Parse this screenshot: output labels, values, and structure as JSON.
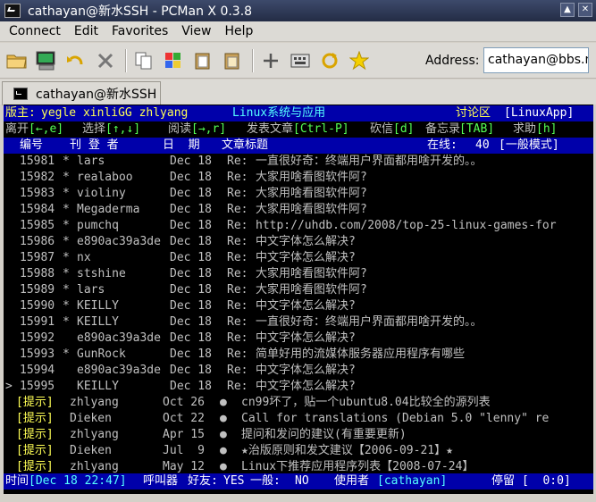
{
  "window": {
    "title": "cathayan@新水SSH - PCMan X 0.3.8",
    "close": "✕",
    "maximize": "▲"
  },
  "menu": [
    "Connect",
    "Edit",
    "Favorites",
    "View",
    "Help"
  ],
  "toolbar": {
    "icons": [
      "open-folder-icon",
      "terminal-icon",
      "reconnect-icon",
      "close-icon",
      "copy-icon",
      "color-copy-icon",
      "paste-icon",
      "paste-file-icon",
      "add-icon",
      "keyboard-icon",
      "refresh-icon",
      "star-icon"
    ],
    "address_label": "Address:",
    "address_value": "cathayan@bbs.n"
  },
  "tab": {
    "label": "cathayan@新水SSH"
  },
  "bbs": {
    "header1": {
      "moderator_label": "版主:",
      "moderators": "yegle xinliGG zhlyang",
      "board_title": "Linux系统与应用",
      "area": "讨论区",
      "board_tag": "[LinuxApp]"
    },
    "header2": {
      "leave": "离开",
      "leave_key": "[←,e]",
      "select": "选择",
      "select_key": "[↑,↓]",
      "read": "阅读",
      "read_key": "[→,r]",
      "post": "发表文章",
      "post_key": "[Ctrl-P]",
      "cut": "砍信",
      "cut_key": "[d]",
      "memo": "备忘录",
      "memo_key": "[TAB]",
      "help": "求助",
      "help_key": "[h]"
    },
    "columns": {
      "num": "编号",
      "author": "刊 登 者",
      "date": "日  期",
      "title": "文章标题",
      "online_label": "在线:",
      "online_count": "40",
      "mode": "[一般模式]"
    },
    "posts": [
      {
        "num": "15981",
        "mark": "*",
        "author": "lars",
        "date": "Dec 18",
        "re": "Re:",
        "title": "一直很好奇：终端用户界面都用啥开发的。。"
      },
      {
        "num": "15982",
        "mark": "*",
        "author": "realaboo",
        "date": "Dec 18",
        "re": "Re:",
        "title": "大家用啥看图软件阿?"
      },
      {
        "num": "15983",
        "mark": "*",
        "author": "violiny",
        "date": "Dec 18",
        "re": "Re:",
        "title": "大家用啥看图软件阿?"
      },
      {
        "num": "15984",
        "mark": "*",
        "author": "Megaderma",
        "date": "Dec 18",
        "re": "Re:",
        "title": "大家用啥看图软件阿?"
      },
      {
        "num": "15985",
        "mark": "*",
        "author": "pumchq",
        "date": "Dec 18",
        "re": "Re:",
        "title": "http://uhdb.com/2008/top-25-linux-games-for"
      },
      {
        "num": "15986",
        "mark": "*",
        "author": "e890ac39a3de",
        "date": "Dec 18",
        "re": "Re:",
        "title": "中文字体怎么解决?"
      },
      {
        "num": "15987",
        "mark": "*",
        "author": "nx",
        "date": "Dec 18",
        "re": "Re:",
        "title": "中文字体怎么解决?"
      },
      {
        "num": "15988",
        "mark": "*",
        "author": "stshine",
        "date": "Dec 18",
        "re": "Re:",
        "title": "大家用啥看图软件阿?"
      },
      {
        "num": "15989",
        "mark": "*",
        "author": "lars",
        "date": "Dec 18",
        "re": "Re:",
        "title": "大家用啥看图软件阿?"
      },
      {
        "num": "15990",
        "mark": "*",
        "author": "KEILLY",
        "date": "Dec 18",
        "re": "Re:",
        "title": "中文字体怎么解决?"
      },
      {
        "num": "15991",
        "mark": "*",
        "author": "KEILLY",
        "date": "Dec 18",
        "re": "Re:",
        "title": "一直很好奇：终端用户界面都用啥开发的。。"
      },
      {
        "num": "15992",
        "mark": "",
        "author": "e890ac39a3de",
        "date": "Dec 18",
        "re": "Re:",
        "title": "中文字体怎么解决?"
      },
      {
        "num": "15993",
        "mark": "*",
        "author": "GunRock",
        "date": "Dec 18",
        "re": "Re:",
        "title": "简单好用的流媒体服务器应用程序有哪些"
      },
      {
        "num": "15994",
        "mark": "",
        "author": "e890ac39a3de",
        "date": "Dec 18",
        "re": "Re:",
        "title": "中文字体怎么解决?"
      },
      {
        "num": "15995",
        "mark": "",
        "author": "KEILLY",
        "date": "Dec 18",
        "re": "Re:",
        "title": "中文字体怎么解决?"
      }
    ],
    "cursor": ">",
    "notices": [
      {
        "tag": "[提示]",
        "author": "zhlyang",
        "date": "Oct 26",
        "bullet": "●",
        "title": "cn99坏了，贴一个ubuntu8.04比较全的源列表"
      },
      {
        "tag": "[提示]",
        "author": "Dieken",
        "date": "Oct 22",
        "bullet": "●",
        "title": "Call for translations (Debian 5.0 \"lenny\" re"
      },
      {
        "tag": "[提示]",
        "author": "zhlyang",
        "date": "Apr 15",
        "bullet": "●",
        "title": "提问和发问的建议(有重要更新)"
      },
      {
        "tag": "[提示]",
        "author": "Dieken",
        "date": "Jul  9",
        "bullet": "●",
        "title": "★治版原则和发文建议【2006-09-21】★"
      },
      {
        "tag": "[提示]",
        "author": "zhlyang",
        "date": "May 12",
        "bullet": "●",
        "title": "Linux下推荐应用程序列表【2008-07-24】"
      }
    ],
    "status": {
      "time_label": "时间",
      "time": "[Dec 18 22:47]",
      "caller_label": "呼叫器",
      "friend_label": "好友:",
      "friend": "YES",
      "general_label": "一般:",
      "general": "NO",
      "user_label": "使用者",
      "user": "[cathayan]",
      "idle_label": "停留",
      "idle": "[  0:0]"
    }
  },
  "colors": {
    "term_bg": "#000000",
    "bar_bg": "#0000aa",
    "yellow": "#ffff55",
    "cyan": "#55ffff",
    "green": "#55ff55"
  }
}
